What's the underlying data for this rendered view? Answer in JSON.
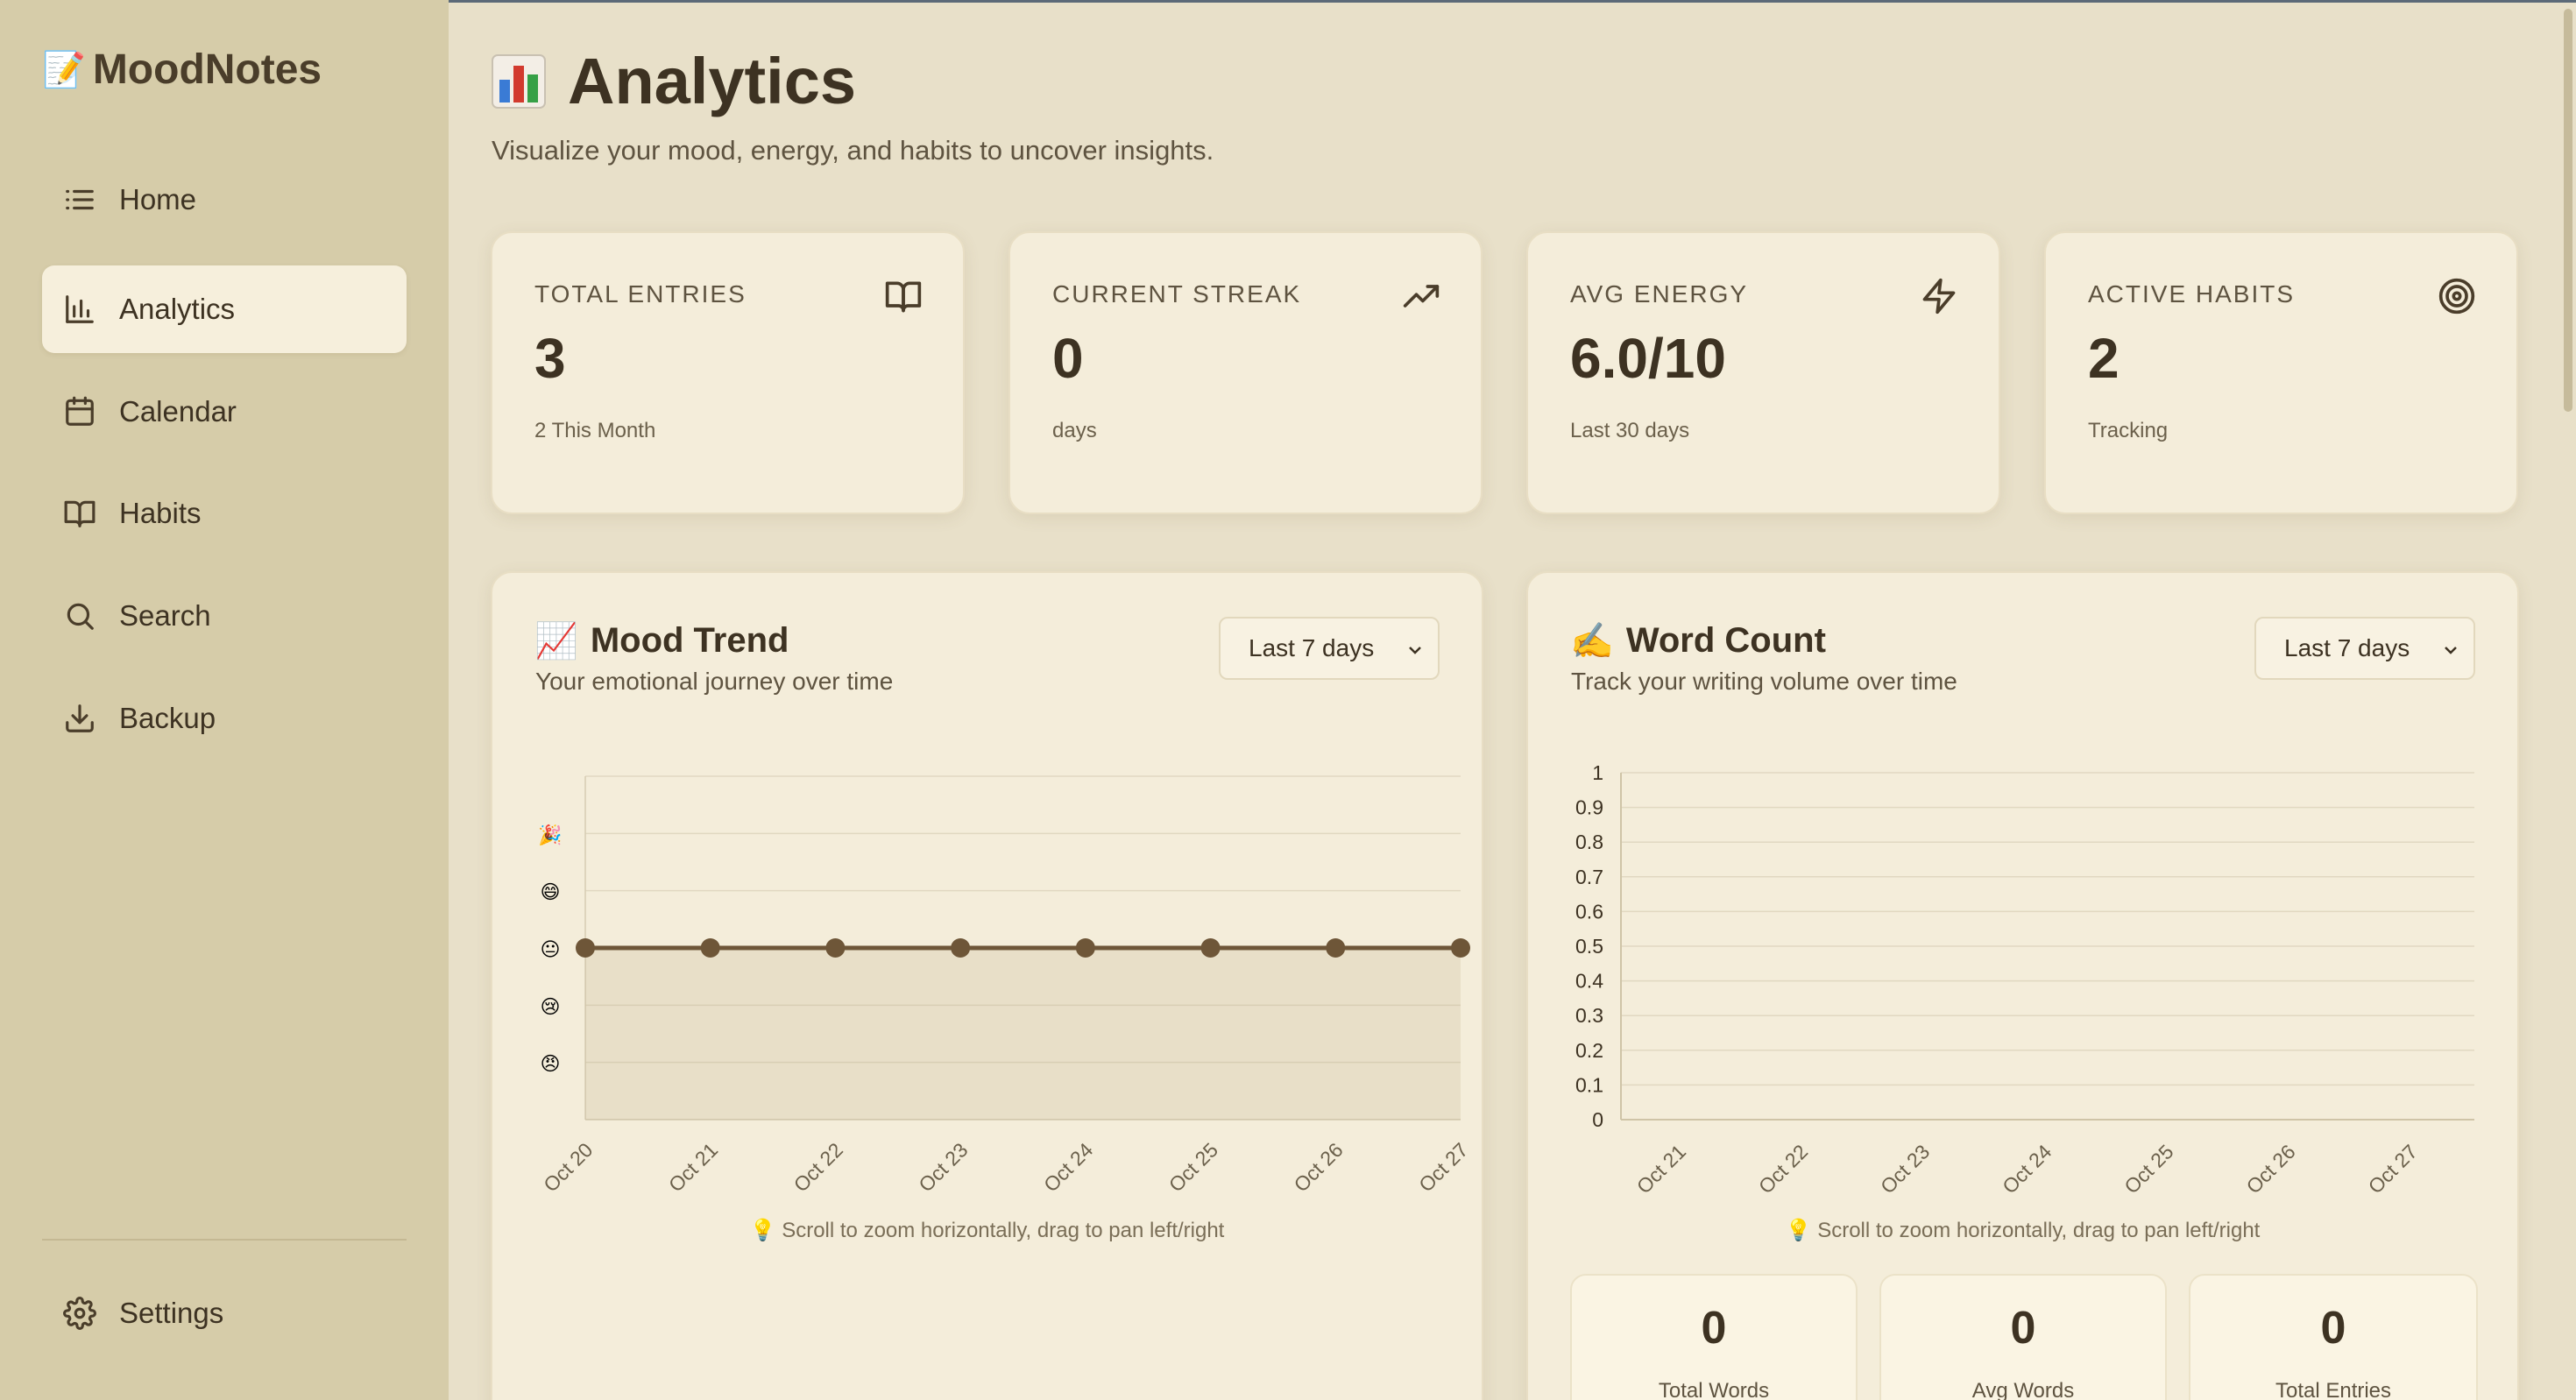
{
  "app": {
    "brand": "MoodNotes",
    "brand_icon": "📝"
  },
  "sidebar": {
    "items": [
      {
        "label": "Home",
        "icon": "list-icon",
        "active": false
      },
      {
        "label": "Analytics",
        "icon": "bar-chart-icon",
        "active": true
      },
      {
        "label": "Calendar",
        "icon": "calendar-icon",
        "active": false
      },
      {
        "label": "Habits",
        "icon": "book-icon",
        "active": false
      },
      {
        "label": "Search",
        "icon": "search-icon",
        "active": false
      },
      {
        "label": "Backup",
        "icon": "download-icon",
        "active": false
      }
    ],
    "settings_label": "Settings"
  },
  "page": {
    "title_icon": "📊",
    "title": "Analytics",
    "subtitle": "Visualize your mood, energy, and habits to uncover insights."
  },
  "stats": [
    {
      "label": "TOTAL ENTRIES",
      "value": "3",
      "sub": "2 This Month",
      "icon": "book-icon"
    },
    {
      "label": "CURRENT STREAK",
      "value": "0",
      "sub": "days",
      "icon": "trending-up-icon"
    },
    {
      "label": "AVG ENERGY",
      "value": "6.0/10",
      "sub": "Last 30 days",
      "icon": "zap-icon"
    },
    {
      "label": "ACTIVE HABITS",
      "value": "2",
      "sub": "Tracking",
      "icon": "target-icon"
    }
  ],
  "mood_panel": {
    "icon": "📈",
    "title": "Mood Trend",
    "subtitle": "Your emotional journey over time",
    "range_select": "Last 7 days",
    "hint": "💡 Scroll to zoom horizontally, drag to pan left/right"
  },
  "word_panel": {
    "icon": "✍️",
    "title": "Word Count",
    "subtitle": "Track your writing volume over time",
    "range_select": "Last 7 days",
    "hint": "💡 Scroll to zoom horizontally, drag to pan left/right",
    "summary": [
      {
        "value": "0",
        "label": "Total Words"
      },
      {
        "value": "0",
        "label": "Avg Words"
      },
      {
        "value": "0",
        "label": "Total Entries"
      }
    ]
  },
  "chart_data": [
    {
      "type": "area",
      "x": [
        "Oct 20",
        "Oct 21",
        "Oct 22",
        "Oct 23",
        "Oct 24",
        "Oct 25",
        "Oct 26",
        "Oct 27"
      ],
      "y_tick_labels": [
        "😠",
        "😢",
        "😐",
        "😄",
        "🎉"
      ],
      "y": [
        3,
        3,
        3,
        3,
        3,
        3,
        3,
        3
      ],
      "ylim": [
        0,
        6
      ],
      "grid": true,
      "color": "#6e5638"
    },
    {
      "type": "bar",
      "categories": [
        "Oct 21",
        "Oct 22",
        "Oct 23",
        "Oct 24",
        "Oct 25",
        "Oct 26",
        "Oct 27"
      ],
      "values": [
        0,
        0,
        0,
        0,
        0,
        0,
        0
      ],
      "y_ticks": [
        "0",
        "0.1",
        "0.2",
        "0.3",
        "0.4",
        "0.5",
        "0.6",
        "0.7",
        "0.8",
        "0.9",
        "1"
      ],
      "ylim": [
        0,
        1
      ],
      "grid": true
    }
  ]
}
